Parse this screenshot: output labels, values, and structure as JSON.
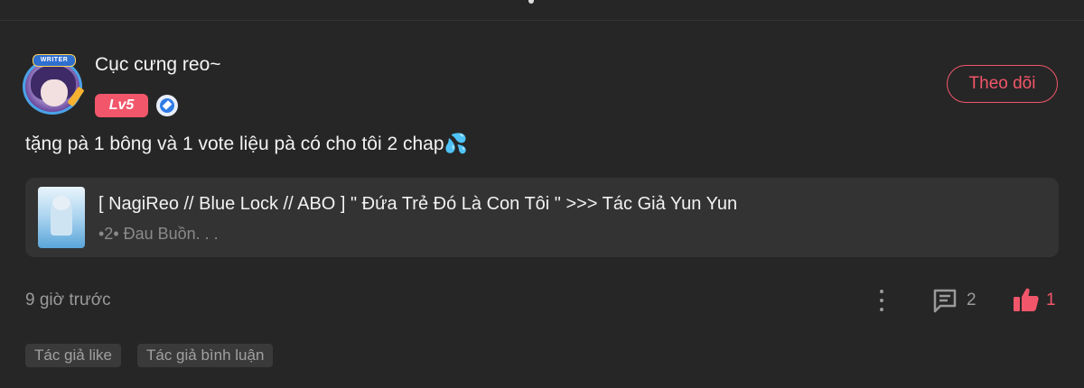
{
  "comment": {
    "username": "Cục cưng reo~",
    "level": "Lv5",
    "avatar_badge": "WRITER",
    "follow_label": "Theo dõi",
    "text": "tặng pà 1 bông và 1 vote liệu pà có cho tôi 2 chap💦",
    "timestamp": "9 giờ trước",
    "reply_count": "2",
    "like_count": "1"
  },
  "story": {
    "title": "[ NagiReo // Blue Lock // ABO ] \" Đứa Trẻ Đó Là Con Tôi \" >>> Tác Giả Yun Yun",
    "chapter": "•2• Đau Buồn. . ."
  },
  "tags": [
    "Tác giả like",
    "Tác giả bình luận"
  ],
  "icons": {
    "verified": "verified-icon",
    "more": "more-vertical-icon",
    "reply": "comment-icon",
    "like": "thumbs-up-icon"
  },
  "colors": {
    "accent": "#f2566a",
    "background": "#262626",
    "card": "#333333",
    "muted": "#9a9a9a"
  }
}
